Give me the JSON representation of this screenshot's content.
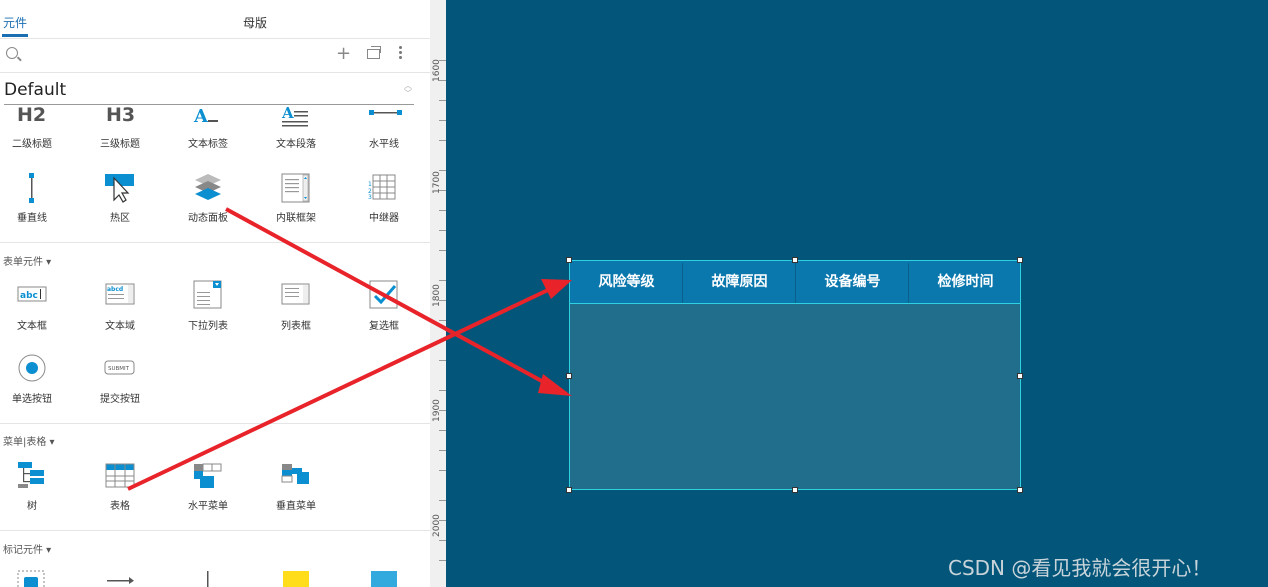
{
  "tabs": {
    "active": "元件",
    "master": "母版"
  },
  "library": {
    "name": "Default"
  },
  "sections": {
    "form": "表单元件 ▾",
    "menu_table": "菜单|表格 ▾",
    "markup": "标记元件 ▾"
  },
  "widgets": {
    "h2_text": "H2",
    "h3_text": "H3",
    "h2": "二级标题",
    "h3": "三级标题",
    "text_label": "文本标签",
    "text_para": "文本段落",
    "hline": "水平线",
    "vline": "垂直线",
    "hotspot": "热区",
    "dynamic_panel": "动态面板",
    "inline_frame": "内联框架",
    "repeater": "中继器",
    "textbox": "文本框",
    "textarea": "文本域",
    "dropdown": "下拉列表",
    "listbox": "列表框",
    "checkbox": "复选框",
    "radio": "单选按钮",
    "submit": "提交按钮",
    "tree": "树",
    "table": "表格",
    "hmenu": "水平菜单",
    "vmenu": "垂直菜单"
  },
  "ruler": {
    "labels": [
      "1600",
      "1700",
      "1800",
      "1900",
      "2000"
    ]
  },
  "table": {
    "headers": [
      "风险等级",
      "故障原因",
      "设备编号",
      "检修时间"
    ]
  },
  "colors": {
    "canvas": "#035679",
    "header": "#0b78ad",
    "body": "#216e8c",
    "border": "#2fd0e0",
    "arrow": "#e8232a",
    "accent": "#1a6fb3"
  },
  "watermark": "CSDN @看见我就会很开心！"
}
